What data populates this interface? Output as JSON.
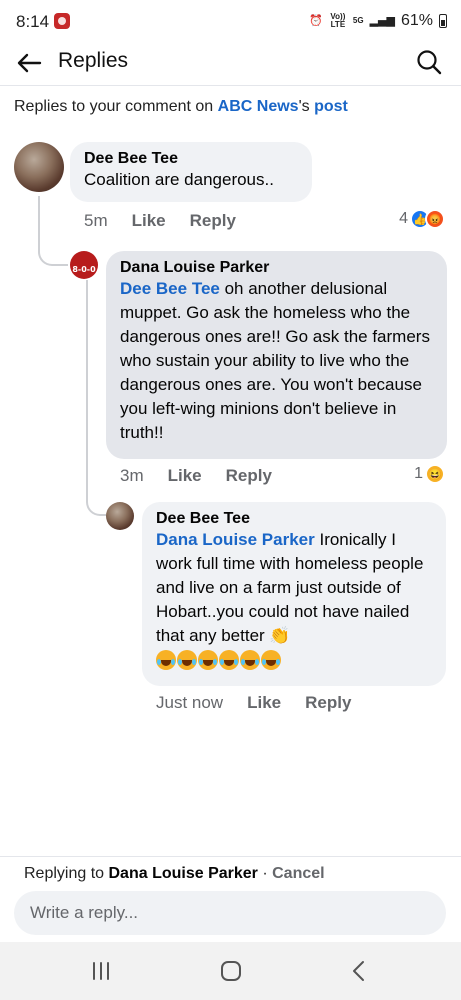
{
  "status": {
    "time": "8:14",
    "battery": "61%",
    "volte": "Vo)) LTE",
    "network": "5G"
  },
  "header": {
    "title": "Replies"
  },
  "context": {
    "prefix": "Replies to your comment on ",
    "page": "ABC News",
    "possessive": "'s ",
    "post": "post"
  },
  "comments": [
    {
      "author": "Dee Bee Tee",
      "text": "Coalition are dangerous..",
      "time": "5m",
      "like": "Like",
      "reply": "Reply",
      "reaction_count": "4",
      "reactions": [
        "like-icon",
        "angry-icon"
      ]
    },
    {
      "author": "Dana Louise Parker",
      "avatar_text": "8-0-0",
      "mention": "Dee Bee Tee",
      "text": " oh another delusional muppet. Go ask the homeless who the dangerous ones are!! Go ask the farmers who sustain your ability to live who the dangerous ones are. You won't because you left-wing minions don't believe in truth!!",
      "time": "3m",
      "like": "Like",
      "reply": "Reply",
      "reaction_count": "1",
      "reactions": [
        "haha-icon"
      ]
    },
    {
      "author": "Dee Bee Tee",
      "mention": "Dana Louise Parker",
      "text": " Ironically I work full time with homeless people and live on a farm just outside of Hobart..you could not have nailed that any better",
      "clap": "👏",
      "time": "Just now",
      "like": "Like",
      "reply": "Reply"
    }
  ],
  "reply_bar": {
    "replying_to_prefix": "Replying to ",
    "replying_to": "Dana Louise Parker",
    "separator": " · ",
    "cancel": "Cancel",
    "placeholder": "Write a reply..."
  },
  "colors": {
    "link": "#1a66c7",
    "bubble": "#f0f2f5",
    "bubble_selected": "#e4e6eb",
    "meta": "#65676b"
  }
}
